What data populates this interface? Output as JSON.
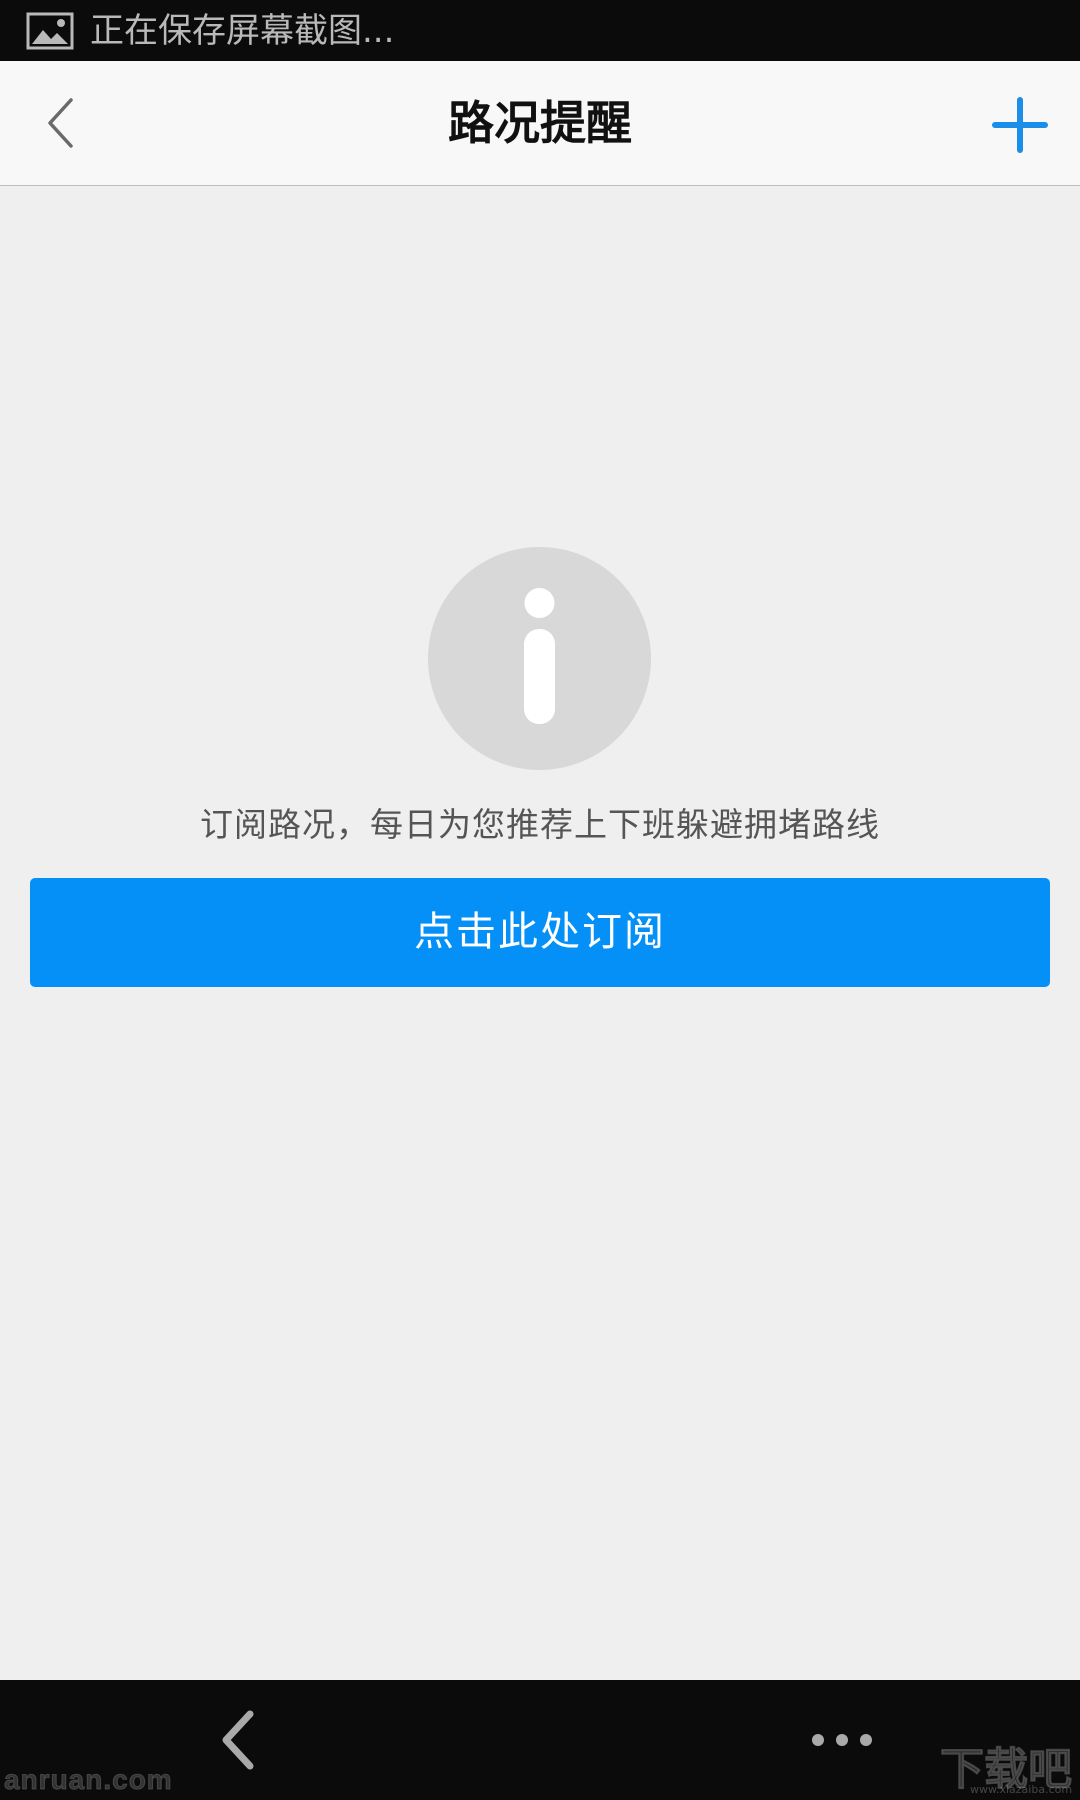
{
  "status_bar": {
    "icon": "image-icon",
    "text": "正在保存屏幕截图..."
  },
  "header": {
    "title": "路况提醒",
    "back_icon": "chevron-left-icon",
    "add_icon": "plus-icon",
    "accent_color": "#1a8ee8"
  },
  "empty_state": {
    "icon": "info-icon",
    "message": "订阅路况，每日为您推荐上下班躲避拥堵路线",
    "button_label": "点击此处订阅",
    "button_color": "#0490f7"
  },
  "bottom_nav": {
    "back_icon": "chevron-left-icon",
    "more_icon": "more-dots-icon"
  },
  "watermarks": {
    "left": "anruan.com",
    "right": "下载吧",
    "right_sub": "www.xiazaiba.com"
  }
}
